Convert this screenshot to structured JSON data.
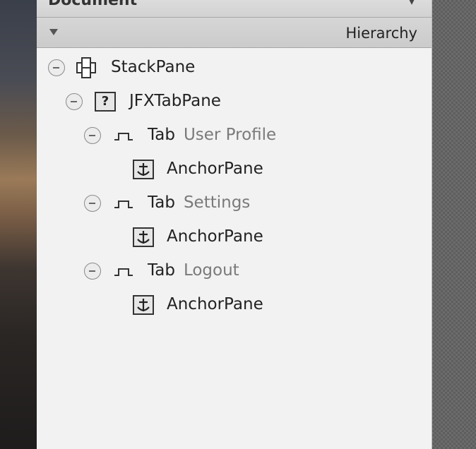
{
  "document_header": {
    "title": "Document"
  },
  "hierarchy_header": {
    "label": "Hierarchy"
  },
  "tree": {
    "stackpane": {
      "label": "StackPane"
    },
    "jfxtabpane": {
      "label": "JFXTabPane",
      "icon_glyph": "?"
    },
    "tabs": [
      {
        "type": "Tab",
        "title": "User Profile",
        "child": "AnchorPane"
      },
      {
        "type": "Tab",
        "title": "Settings",
        "child": "AnchorPane"
      },
      {
        "type": "Tab",
        "title": "Logout",
        "child": "AnchorPane"
      }
    ]
  },
  "colors": {
    "panel_bg": "#f2f2f2",
    "header_bg": "#cfcfcf",
    "text": "#222222",
    "secondary_text": "#7a7a7a"
  }
}
